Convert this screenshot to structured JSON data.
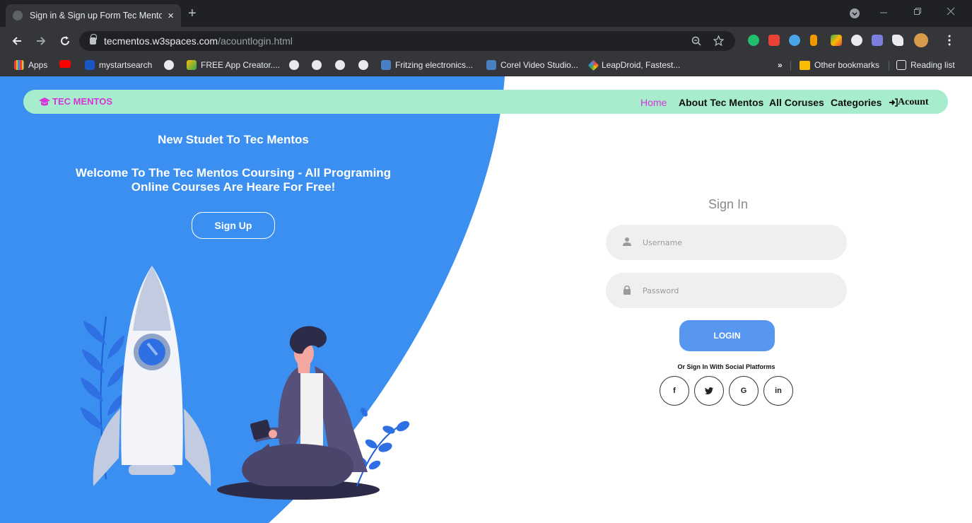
{
  "browser": {
    "tab_title": "Sign in & Sign up Form Tec Mentos",
    "tab_close": "×",
    "new_tab": "+",
    "url_host": "tecmentos.w3spaces.com",
    "url_path": "/acountlogin.html"
  },
  "bookmarks": {
    "apps": "Apps",
    "items": [
      "mystartsearch",
      "FREE App Creator....",
      "Fritzing electronics...",
      "Corel Video Studio...",
      "LeapDroid, Fastest..."
    ],
    "more": "»",
    "other": "Other bookmarks",
    "reading_list": "Reading list"
  },
  "site": {
    "brand": "TEC MENTOS",
    "nav": {
      "home": "Home",
      "about": "About Tec Mentos",
      "courses": "All Coruses",
      "categories": "Categories",
      "account": "Acount"
    },
    "hero": {
      "heading": "New Studet To Tec Mentos",
      "subheading": "Welcome To The Tec Mentos Coursing - All Programing Online Courses Are Heare For Free!",
      "signup_label": "Sign Up"
    },
    "form": {
      "title": "Sign In",
      "username_placeholder": "Username",
      "password_placeholder": "Password",
      "login_label": "LOGIN",
      "social_text": "Or Sign In With Social Platforms",
      "social": {
        "facebook": "f",
        "twitter": "🐦",
        "google": "G",
        "linkedin": "in"
      }
    }
  },
  "colors": {
    "hero_blue": "#3a8ff0",
    "navbar_mint": "#a7eccc",
    "brand_magenta": "#d633d8",
    "login_blue": "#5797ef"
  }
}
